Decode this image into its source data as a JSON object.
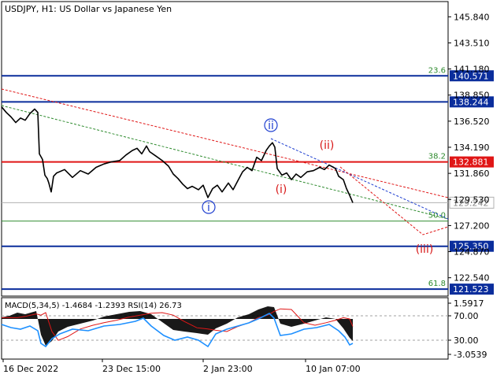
{
  "header": {
    "symbol_label": "USDJPY, H1:  US Dollar vs Japanese Yen"
  },
  "colors": {
    "background": "#ffffff",
    "frame": "#000000",
    "price_line": "#000000",
    "blue_level": "#0a2d9c",
    "red_level": "#e01616",
    "current_price": "#b0b0b0",
    "fib_green": "#2e8b2e",
    "fib_line": "#2e8b2e",
    "green_trend": "#2e8b2e",
    "red_trend": "#e01616",
    "blue_trend": "#1f3fd0",
    "wave_blue": "#1f3fd0",
    "wave_red": "#d81818",
    "macd_hist": "#000000",
    "macd_signal": "#e01616",
    "rsi_line": "#1e90ff"
  },
  "chart_data": {
    "type": "line",
    "title": "USDJPY, H1:  US Dollar vs Japanese Yen",
    "y_axis": {
      "ticks": [
        "145.840",
        "143.510",
        "141.180",
        "138.850",
        "136.520",
        "134.190",
        "131.860",
        "129.530",
        "127.200",
        "124.870",
        "122.540"
      ],
      "range": [
        120.9,
        147.2
      ]
    },
    "x_axis": {
      "ticks": [
        "16 Dec 2022",
        "23 Dec 15:00",
        "2 Jan 23:00",
        "10 Jan 07:00"
      ]
    },
    "price_series": [
      [
        0,
        137.8
      ],
      [
        6,
        137.3
      ],
      [
        12,
        136.9
      ],
      [
        18,
        136.4
      ],
      [
        24,
        136.8
      ],
      [
        30,
        136.6
      ],
      [
        36,
        137.2
      ],
      [
        42,
        137.6
      ],
      [
        46,
        137.3
      ],
      [
        48,
        133.6
      ],
      [
        52,
        133.1
      ],
      [
        55,
        131.7
      ],
      [
        58,
        131.4
      ],
      [
        60,
        131.0
      ],
      [
        63,
        130.2
      ],
      [
        66,
        131.6
      ],
      [
        70,
        131.9
      ],
      [
        80,
        132.2
      ],
      [
        90,
        131.5
      ],
      [
        100,
        132.1
      ],
      [
        110,
        131.8
      ],
      [
        120,
        132.4
      ],
      [
        130,
        132.7
      ],
      [
        140,
        132.9
      ],
      [
        150,
        133.0
      ],
      [
        158,
        133.5
      ],
      [
        166,
        133.9
      ],
      [
        172,
        134.1
      ],
      [
        178,
        133.6
      ],
      [
        184,
        134.3
      ],
      [
        188,
        133.8
      ],
      [
        196,
        133.4
      ],
      [
        204,
        133.0
      ],
      [
        212,
        132.5
      ],
      [
        218,
        131.8
      ],
      [
        224,
        131.4
      ],
      [
        230,
        130.9
      ],
      [
        236,
        130.5
      ],
      [
        242,
        130.7
      ],
      [
        250,
        130.4
      ],
      [
        256,
        130.8
      ],
      [
        262,
        129.7
      ],
      [
        268,
        130.5
      ],
      [
        274,
        130.8
      ],
      [
        280,
        130.2
      ],
      [
        288,
        131.0
      ],
      [
        294,
        130.4
      ],
      [
        300,
        131.2
      ],
      [
        306,
        132.0
      ],
      [
        312,
        132.4
      ],
      [
        318,
        132.1
      ],
      [
        324,
        133.3
      ],
      [
        330,
        133.0
      ],
      [
        336,
        133.9
      ],
      [
        340,
        134.3
      ],
      [
        344,
        134.6
      ],
      [
        347,
        134.2
      ],
      [
        350,
        132.3
      ],
      [
        356,
        131.7
      ],
      [
        362,
        131.9
      ],
      [
        368,
        131.3
      ],
      [
        374,
        131.8
      ],
      [
        380,
        131.5
      ],
      [
        388,
        132.0
      ],
      [
        396,
        132.1
      ],
      [
        404,
        132.4
      ],
      [
        410,
        132.2
      ],
      [
        416,
        132.6
      ],
      [
        424,
        132.3
      ],
      [
        428,
        131.6
      ],
      [
        434,
        131.3
      ],
      [
        438,
        130.5
      ],
      [
        442,
        129.9
      ],
      [
        446,
        129.24
      ]
    ],
    "levels": [
      {
        "value": 140.571,
        "label": "140.571",
        "color": "blue",
        "fib_label": "23.6"
      },
      {
        "value": 138.244,
        "label": "138.244",
        "color": "blue",
        "fib_label": ""
      },
      {
        "value": 132.881,
        "label": "132.881",
        "color": "red",
        "fib_label": "38.2"
      },
      {
        "value": 129.242,
        "label": "129.242",
        "color": "gray",
        "fib_label": ""
      },
      {
        "value": 127.6,
        "label": "",
        "color": "green",
        "fib_label": "50.0"
      },
      {
        "value": 125.35,
        "label": "125.350",
        "color": "blue",
        "fib_label": ""
      },
      {
        "value": 121.523,
        "label": "121.523",
        "color": "blue",
        "fib_label": "61.8"
      }
    ],
    "wave_labels": [
      {
        "text": "i",
        "color": "blue",
        "circled": true
      },
      {
        "text": "ii",
        "color": "blue",
        "circled": true
      },
      {
        "text": "(i)",
        "color": "red",
        "circled": false
      },
      {
        "text": "(ii)",
        "color": "red",
        "circled": false
      },
      {
        "text": "(iii)",
        "color": "red",
        "circled": false
      }
    ],
    "indicator": {
      "label": "MACD(5,34,5) -1.4684 -1.2393 RSI(14) 26.73",
      "ticks": [
        "1.5917",
        "70.00",
        "30.00",
        "-3.0539"
      ],
      "rsi_levels": [
        70,
        30
      ]
    }
  }
}
